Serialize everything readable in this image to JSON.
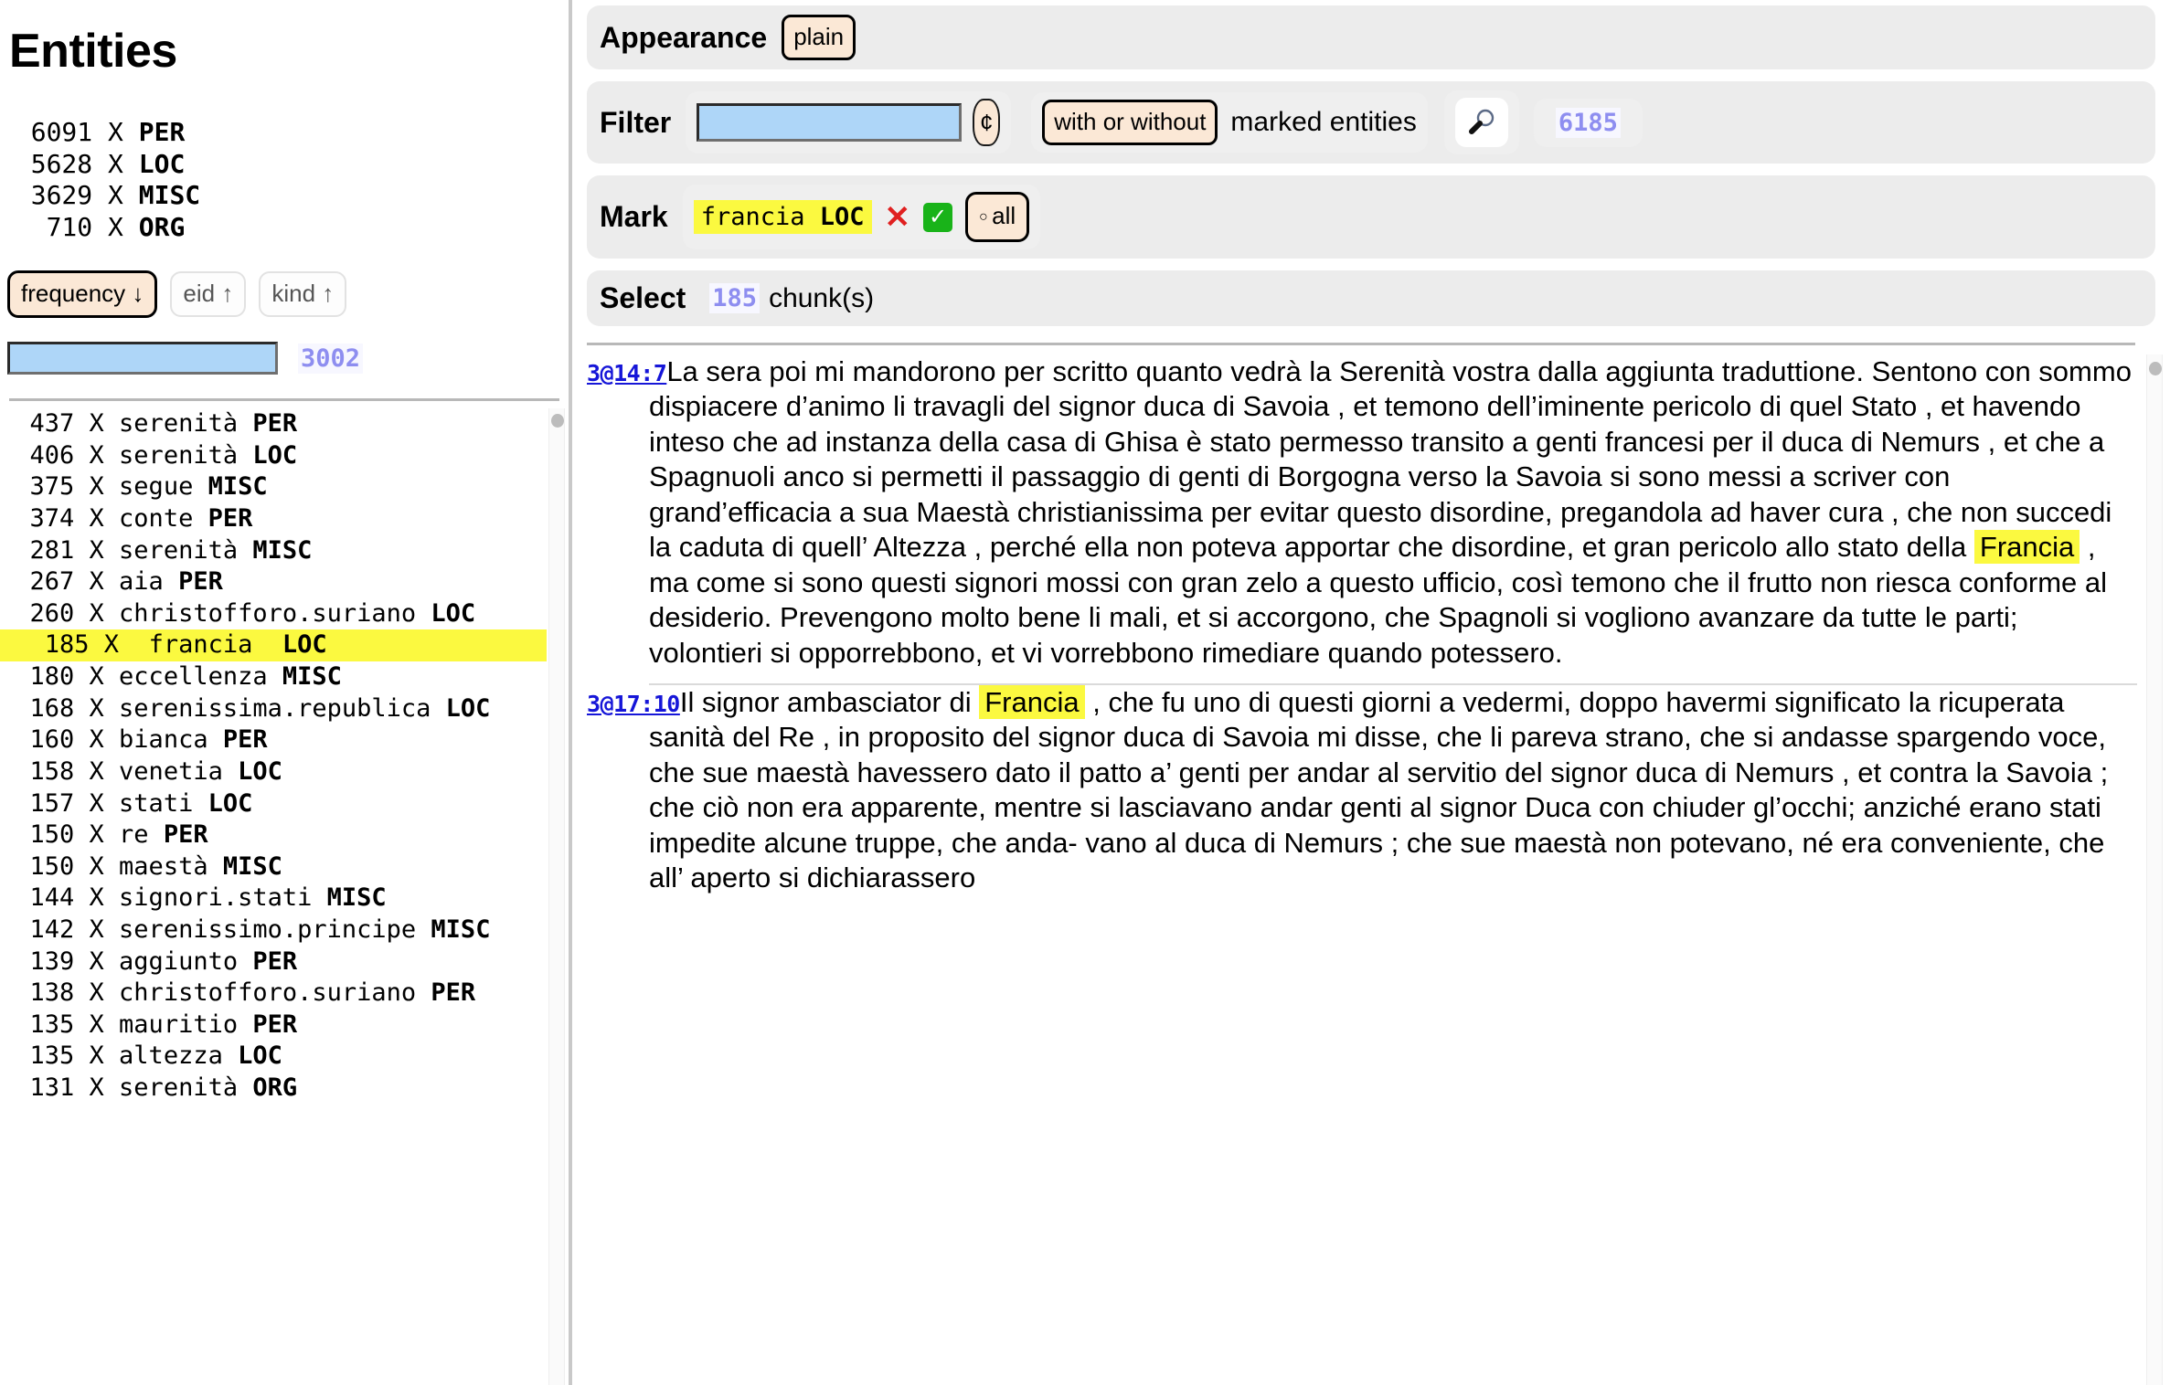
{
  "sidebar": {
    "title": "Entities",
    "kind_counts": [
      {
        "count": "6091",
        "sep": "X",
        "kind": "PER"
      },
      {
        "count": "5628",
        "sep": "X",
        "kind": "LOC"
      },
      {
        "count": "3629",
        "sep": "X",
        "kind": "MISC"
      },
      {
        "count": " 710",
        "sep": "X",
        "kind": "ORG"
      }
    ],
    "sort_buttons": [
      {
        "label": "frequency ↓",
        "active": true
      },
      {
        "label": "eid ↑",
        "active": false
      },
      {
        "label": "kind ↑",
        "active": false
      }
    ],
    "filter_input_value": "",
    "filter_input_placeholder": "",
    "match_count": "3002",
    "entities": [
      {
        "count": "437",
        "name": "serenità",
        "kind": "PER",
        "selected": false
      },
      {
        "count": "406",
        "name": "serenità",
        "kind": "LOC",
        "selected": false
      },
      {
        "count": "375",
        "name": "segue",
        "kind": "MISC",
        "selected": false
      },
      {
        "count": "374",
        "name": "conte",
        "kind": "PER",
        "selected": false
      },
      {
        "count": "281",
        "name": "serenità",
        "kind": "MISC",
        "selected": false
      },
      {
        "count": "267",
        "name": "aia",
        "kind": "PER",
        "selected": false
      },
      {
        "count": "260",
        "name": "christofforo.suriano",
        "kind": "LOC",
        "selected": false
      },
      {
        "count": "185",
        "name": "francia",
        "kind": "LOC",
        "selected": true
      },
      {
        "count": "180",
        "name": "eccellenza",
        "kind": "MISC",
        "selected": false
      },
      {
        "count": "168",
        "name": "serenissima.republica",
        "kind": "LOC",
        "selected": false
      },
      {
        "count": "160",
        "name": "bianca",
        "kind": "PER",
        "selected": false
      },
      {
        "count": "158",
        "name": "venetia",
        "kind": "LOC",
        "selected": false
      },
      {
        "count": "157",
        "name": "stati",
        "kind": "LOC",
        "selected": false
      },
      {
        "count": "150",
        "name": "re",
        "kind": "PER",
        "selected": false
      },
      {
        "count": "150",
        "name": "maestà",
        "kind": "MISC",
        "selected": false
      },
      {
        "count": "144",
        "name": "signori.stati",
        "kind": "MISC",
        "selected": false
      },
      {
        "count": "142",
        "name": "serenissimo.principe",
        "kind": "MISC",
        "selected": false
      },
      {
        "count": "139",
        "name": "aggiunto",
        "kind": "PER",
        "selected": false
      },
      {
        "count": "138",
        "name": "christofforo.suriano",
        "kind": "PER",
        "selected": false
      },
      {
        "count": "135",
        "name": "mauritio",
        "kind": "PER",
        "selected": false
      },
      {
        "count": "135",
        "name": "altezza",
        "kind": "LOC",
        "selected": false
      },
      {
        "count": "131",
        "name": "serenità",
        "kind": "ORG",
        "selected": false
      }
    ]
  },
  "appearance": {
    "label": "Appearance",
    "mode_button": "plain"
  },
  "filter": {
    "label": "Filter",
    "input_value": "",
    "input_placeholder": "",
    "cent_button": "¢",
    "mode_button": "with or without",
    "mode_suffix": "marked entities",
    "search_icon": "magnifier-icon",
    "result_count": "6185"
  },
  "mark": {
    "label": "Mark",
    "chip_name": "francia",
    "chip_kind": "LOC",
    "remove_icon": "✕",
    "confirm_icon": "✓",
    "all_button": "all",
    "all_button_dot": "○"
  },
  "select": {
    "label": "Select",
    "count": "185",
    "suffix": "chunk(s)"
  },
  "chunks": [
    {
      "id": "3@14:7",
      "parts": [
        {
          "t": "La sera poi mi mandorono per scritto quanto vedrà la ",
          "s": "plain"
        },
        {
          "t": "Serenità",
          "s": "ent"
        },
        {
          "t": " vostra dalla aggiunta traduttione. Sentono con sommo dispiacere d’animo li travagli del signor ",
          "s": "plain"
        },
        {
          "t": "duca di Savoia",
          "s": "ent"
        },
        {
          "t": " , et temono dell’iminente pericolo di quel ",
          "s": "plain"
        },
        {
          "t": "Stato",
          "s": "ent"
        },
        {
          "t": " , et havendo inteso che ad instanza della casa di ",
          "s": "plain"
        },
        {
          "t": "Ghisa",
          "s": "ent"
        },
        {
          "t": " è stato permesso transito a genti francesi per il duca di ",
          "s": "plain"
        },
        {
          "t": "Nemurs",
          "s": "ent"
        },
        {
          "t": " , et che a ",
          "s": "plain"
        },
        {
          "t": "Spagnuoli",
          "s": "ent"
        },
        {
          "t": " anco si permetti il passaggio di genti di ",
          "s": "plain"
        },
        {
          "t": "Borgogna",
          "s": "ent"
        },
        {
          "t": " verso la ",
          "s": "plain"
        },
        {
          "t": "Savoia",
          "s": "ent"
        },
        {
          "t": " si sono messi a scriver con grand’efficacia a sua ",
          "s": "plain"
        },
        {
          "t": "Maestà",
          "s": "ent"
        },
        {
          "t": " christianissima per evitar questo disordine, pregandola ad ",
          "s": "plain"
        },
        {
          "t": "haver cura",
          "s": "ent"
        },
        {
          "t": " , che non succedi la caduta di quell’ ",
          "s": "plain"
        },
        {
          "t": "Altezza",
          "s": "ent"
        },
        {
          "t": " , perché ella non poteva apportar che disordine, et gran pericolo allo stato della ",
          "s": "plain"
        },
        {
          "t": "Francia",
          "s": "hl"
        },
        {
          "t": " , ma come si sono questi signori mossi con gran zelo a questo ufficio, così temono che il frutto non riesca conforme al desiderio. Prevengono molto bene li mali, et si accorgono, che ",
          "s": "plain"
        },
        {
          "t": "Spagnoli",
          "s": "ent"
        },
        {
          "t": " si vogliono avanzare da tutte le parti; volontieri si opporrebbono, et vi vorrebbono rimediare quando potessero.",
          "s": "plain"
        }
      ]
    },
    {
      "id": "3@17:10",
      "parts": [
        {
          "t": "Il signor ambasciator di ",
          "s": "plain"
        },
        {
          "t": "Francia",
          "s": "hl"
        },
        {
          "t": " , che fu uno di questi giorni a vedermi, doppo havermi significato la ricuperata sanità del ",
          "s": "plain"
        },
        {
          "t": "Re",
          "s": "ent"
        },
        {
          "t": " , in proposito del signor ",
          "s": "plain"
        },
        {
          "t": "duca di Savoia",
          "s": "ent"
        },
        {
          "t": " mi disse, che li pareva strano, che si andasse spargendo voce, che sue maestà havessero dato il patto a’ genti per andar al servitio del signor duca di ",
          "s": "plain"
        },
        {
          "t": "Nemurs",
          "s": "ent"
        },
        {
          "t": " , et contra la ",
          "s": "plain"
        },
        {
          "t": "Savoia",
          "s": "ent"
        },
        {
          "t": " ; che ciò non era apparente, mentre si lasciavano andar genti al signor ",
          "s": "plain"
        },
        {
          "t": "Duca",
          "s": "ent"
        },
        {
          "t": " con chiuder gl’occhi; anziché erano stati impedite alcune truppe, che anda- vano al duca di ",
          "s": "plain"
        },
        {
          "t": "Nemurs",
          "s": "ent"
        },
        {
          "t": " ; che sue maestà non potevano, né era conveniente, che all’ aperto si dichiarassero",
          "s": "plain"
        }
      ]
    }
  ]
}
